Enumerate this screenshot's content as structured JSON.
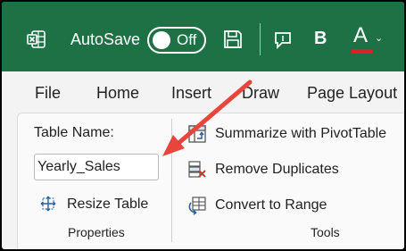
{
  "titlebar": {
    "autosave_label": "AutoSave",
    "autosave_state": "Off",
    "bold_label": "B",
    "font_color_letter": "A",
    "font_color_chevron": "⌄",
    "colors": {
      "background": "#1e7145",
      "font_color_bar": "#e02020"
    },
    "icons": [
      "excel-icon",
      "save-icon",
      "comment-icon"
    ]
  },
  "tabs": [
    {
      "label": "File"
    },
    {
      "label": "Home"
    },
    {
      "label": "Insert"
    },
    {
      "label": "Draw"
    },
    {
      "label": "Page Layout"
    }
  ],
  "properties": {
    "table_name_label": "Table Name:",
    "table_name_value": "Yearly_Sales",
    "resize_label": "Resize Table",
    "group_label": "Properties"
  },
  "tools": {
    "items": [
      {
        "label": "Summarize with PivotTable",
        "icon": "pivot-table-icon"
      },
      {
        "label": "Remove Duplicates",
        "icon": "remove-duplicates-icon"
      },
      {
        "label": "Convert to Range",
        "icon": "convert-range-icon"
      }
    ],
    "group_label": "Tools"
  },
  "annotation": {
    "arrow_color": "#e8453c"
  }
}
